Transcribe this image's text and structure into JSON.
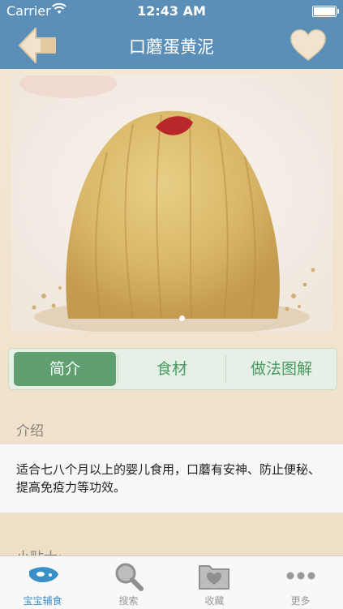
{
  "status_bar": {
    "carrier": "Carrier",
    "time": "12:43 AM"
  },
  "nav": {
    "title": "口蘑蛋黄泥"
  },
  "tabs": [
    {
      "label": "简介",
      "active": true
    },
    {
      "label": "食材",
      "active": false
    },
    {
      "label": "做法图解",
      "active": false
    }
  ],
  "intro": {
    "heading": "介绍",
    "text": "适合七八个月以上的婴儿食用，口蘑有安神、防止便秘、提高免疫力等功效。"
  },
  "tips": {
    "heading": "小贴士:"
  },
  "tab_bar": {
    "items": [
      {
        "label": "宝宝辅食",
        "icon": "baby-bottle-icon",
        "active": true
      },
      {
        "label": "搜索",
        "icon": "search-icon",
        "active": false
      },
      {
        "label": "收藏",
        "icon": "folder-heart-icon",
        "active": false
      },
      {
        "label": "更多",
        "icon": "more-dots-icon",
        "active": false
      }
    ]
  },
  "colors": {
    "nav_blue": "#5b8fb8",
    "tab_green": "#5f9f70",
    "tab_text_green": "#4b9a62",
    "tab_bar_active": "#3a8fc8"
  }
}
